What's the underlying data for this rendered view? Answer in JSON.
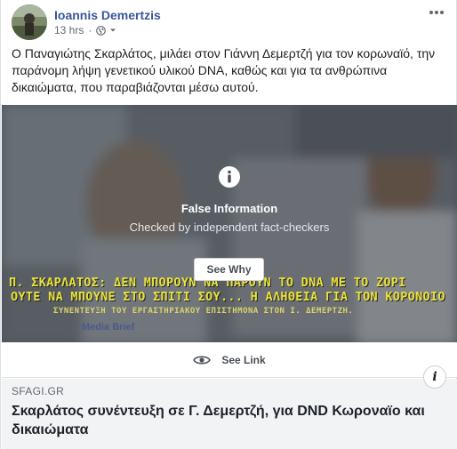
{
  "post": {
    "author": "Ioannis Demertzis",
    "time": "13 hrs",
    "separator": "·",
    "privacy_icon": "globe-icon",
    "text": "Ο Παναγιώτης Σκαρλάτος, μιλάει στον Γιάννη Δεμερτζή για τον κορωναϊό, την παράνομη λήψη γενετικού υλικού DNA, καθώς και για τα ανθρώπινα δικαιώματα, που παραβιάζονται μέσω αυτού."
  },
  "media": {
    "headline_line1": "Π. ΣΚΑΡΛΑΤΟΣ: ΔΕΝ ΜΠΟΡΟΥΝ ΝΑ ΠΑΡΟΥΝ ΤΟ DNA ΜΕ ΤΟ ΖΟΡΙ",
    "headline_line2": "ΟΥΤΕ ΝΑ ΜΠΟΥΝΕ ΣΤΟ ΣΠΙΤΙ ΣΟΥ... Η ΑΛΗΘΕΙΑ ΓΙΑ ΤΟΝ ΚΟΡΟΝΟΙΟ",
    "headline_line3": "ΣΥΝΕΝΤΕΥΞΗ ΤΟΥ ΕΡΓΑΣΤΗΡΙΑΚΟΥ ΕΠΙΣΤΗΜΟΝΑ ΣΤΟΝ Ι. ΔΕΜΕΡΤΖΗ.",
    "brand_text": "Media Brief"
  },
  "warning": {
    "icon": "info-icon",
    "title": "False Information",
    "subtitle": "Checked by independent fact-checkers",
    "button": "See Why"
  },
  "see_link": {
    "icon": "eye-icon",
    "label": "See Link"
  },
  "link_preview": {
    "domain": "SFAGI.GR",
    "title": "Σκαρλάτος συνέντευξη σε Γ. Δεμερτζή, για DND Κωροναϊο και δικαιώματα",
    "info_icon_glyph": "i"
  },
  "colors": {
    "author": "#385898",
    "headline": "#e8e23a",
    "preview_bg": "#f2f3f5"
  }
}
